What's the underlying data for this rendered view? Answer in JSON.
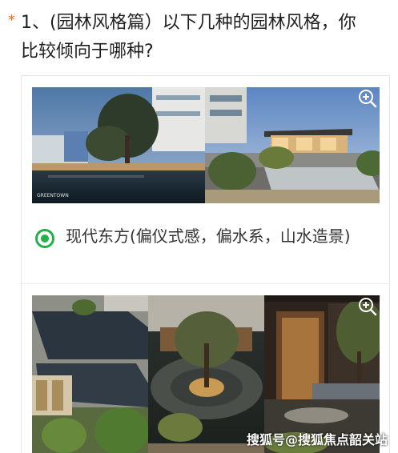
{
  "question": {
    "required_mark": "*",
    "line1": "1、(园林风格篇）以下几种的园林风格，你",
    "line2": "比较倾向于哪种?"
  },
  "options": [
    {
      "label": "现代东方(偏仪式感，偏水系，山水造景)",
      "selected": true,
      "image_caption": "GREENTOWN"
    },
    {
      "label": "",
      "selected": false
    }
  ],
  "icons": {
    "zoom": "zoom-in-icon",
    "radio": "radio-selected-icon"
  },
  "colors": {
    "required": "#ff6b1a",
    "radio_selected": "#20b14a"
  },
  "watermark": "搜狐号@搜狐焦点韶关站"
}
